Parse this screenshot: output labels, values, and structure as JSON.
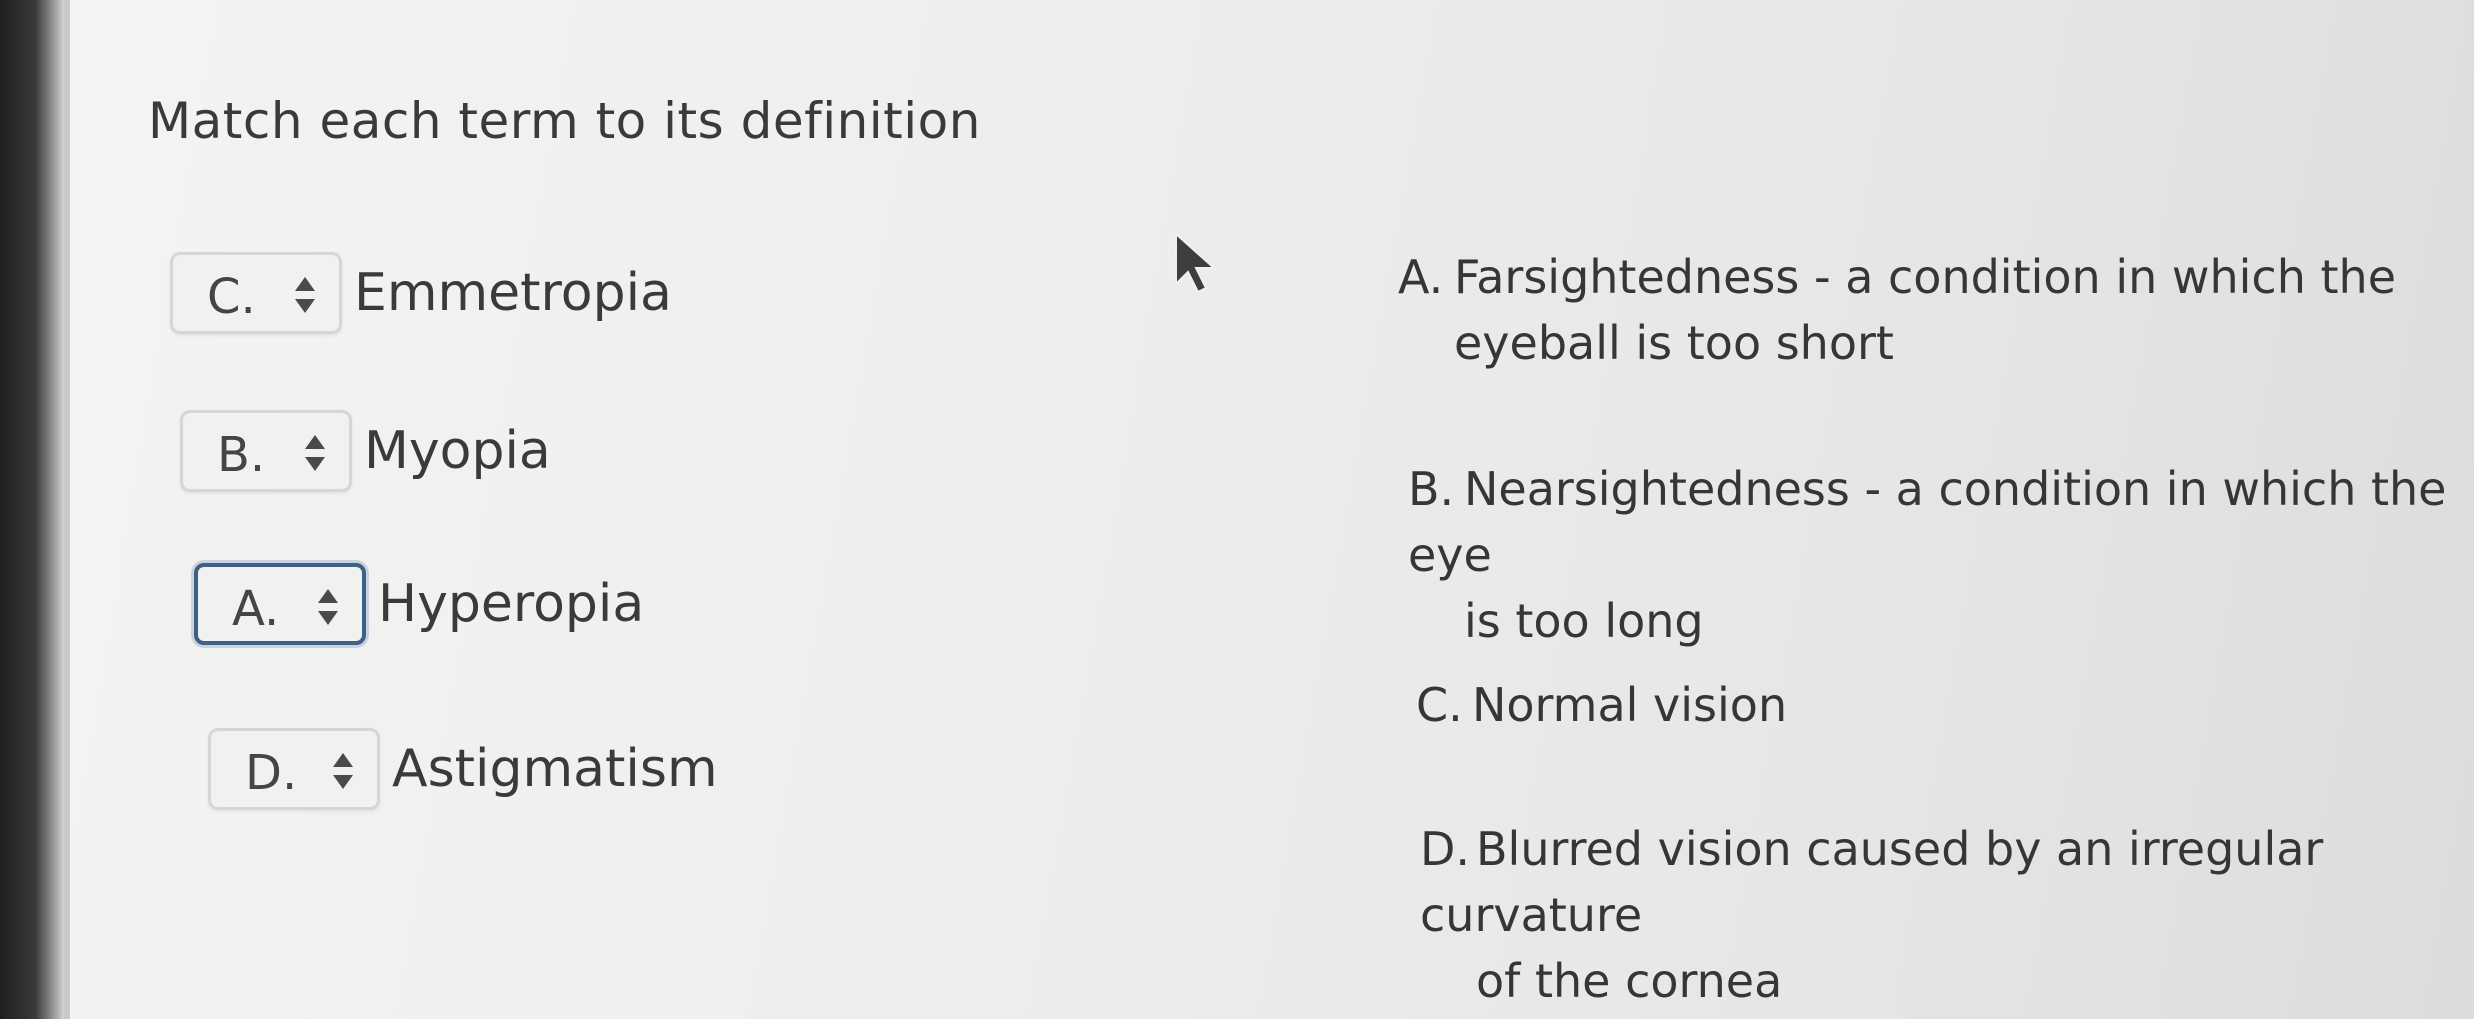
{
  "question": {
    "title": "Match each term to its definition"
  },
  "terms": [
    {
      "selected": "C.",
      "label": "Emmetropia"
    },
    {
      "selected": "B.",
      "label": "Myopia"
    },
    {
      "selected": "A.",
      "label": "Hyperopia"
    },
    {
      "selected": "D.",
      "label": "Astigmatism"
    }
  ],
  "definitions": [
    {
      "letter": "A.",
      "line1": "Farsightedness - a condition in which the",
      "line2": "eyeball is too short"
    },
    {
      "letter": "B.",
      "line1": "Nearsightedness - a condition in which the eye",
      "line2": "is too long"
    },
    {
      "letter": "C.",
      "line1": "Normal vision",
      "line2": ""
    },
    {
      "letter": "D.",
      "line1": "Blurred vision caused by an irregular curvature",
      "line2": "of the cornea"
    }
  ],
  "colors": {
    "focus_border": "#3f5f86",
    "select_border": "#d6d6d4",
    "text": "#3a3a3a"
  },
  "icons": {
    "select_chevron": "up-down-chevron-icon",
    "cursor": "mouse-pointer-icon"
  },
  "state": {
    "focused_select_index": 2
  }
}
